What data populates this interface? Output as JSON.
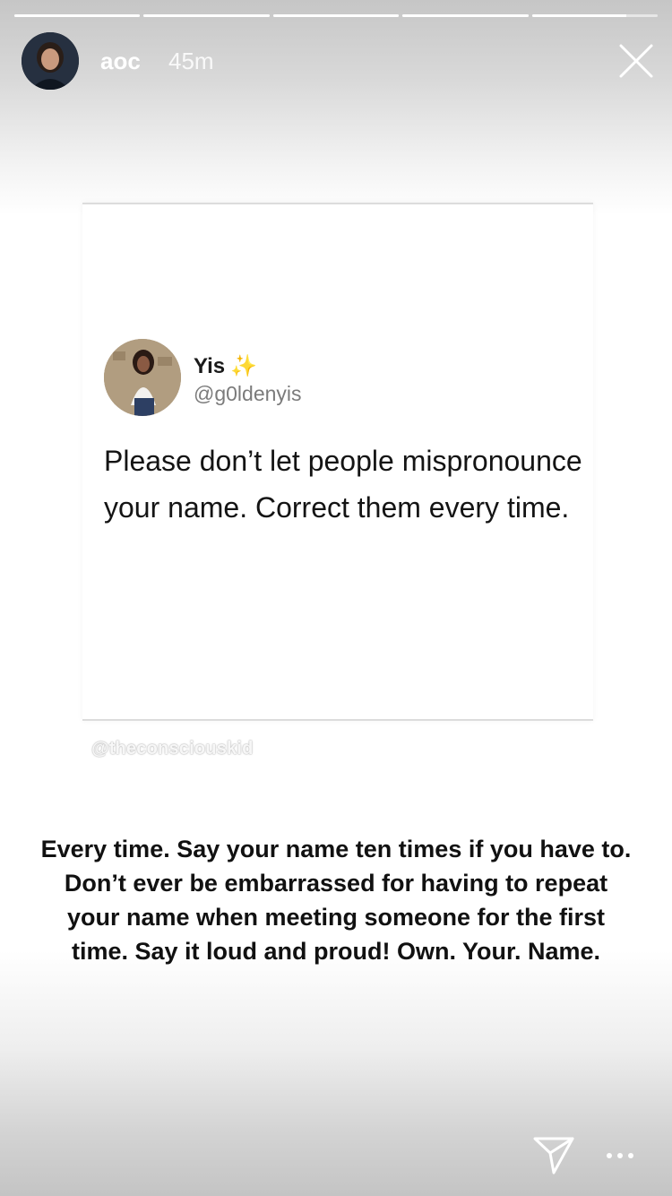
{
  "story": {
    "segments": [
      1,
      1,
      1,
      1,
      0.75
    ]
  },
  "header": {
    "username": "aoc",
    "time_ago": "45m"
  },
  "tweet": {
    "display_name": "Yis",
    "sparkle_emoji": "✨",
    "handle": "@g0ldenyis",
    "text": "Please don’t let people mispronounce your name. Correct them every time."
  },
  "watermark": "@theconsciouskid",
  "caption": "Every time. Say your name ten times if you have to. Don’t ever be embarrassed for having to repeat your name when meeting someone for the first time. Say it loud and proud! Own. Your. Name.",
  "icons": {
    "close": "close-icon",
    "send": "paper-plane-icon",
    "more": "more-options-icon"
  }
}
